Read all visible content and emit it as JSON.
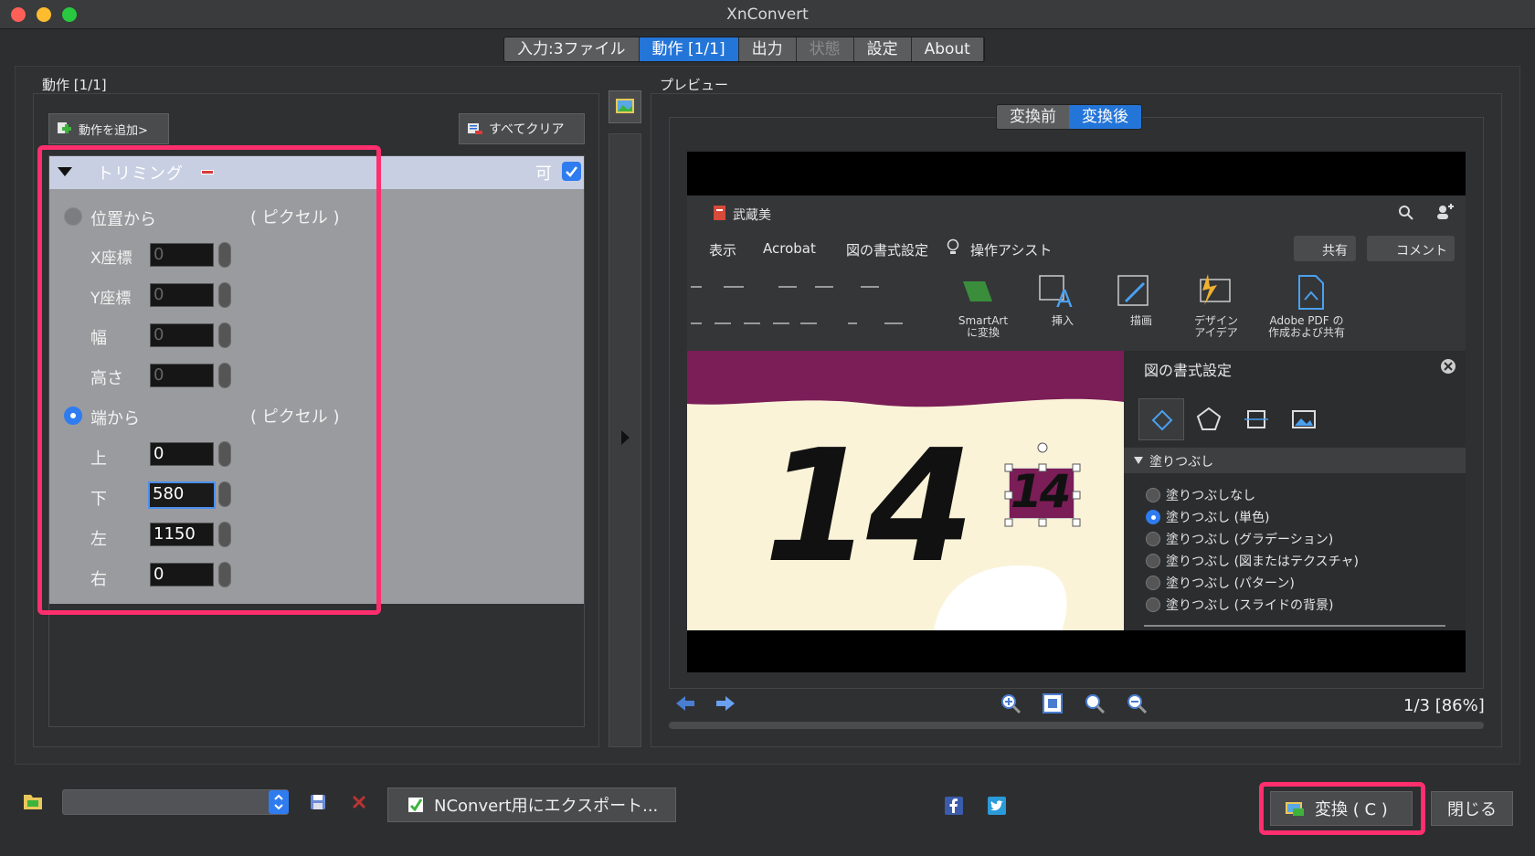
{
  "window": {
    "title": "XnConvert"
  },
  "tabs": [
    {
      "label": "入力:3ファイル",
      "state": "normal"
    },
    {
      "label": "動作 [1/1]",
      "state": "active"
    },
    {
      "label": "出力",
      "state": "normal"
    },
    {
      "label": "状態",
      "state": "disabled"
    },
    {
      "label": "設定",
      "state": "normal"
    },
    {
      "label": "About",
      "state": "normal"
    }
  ],
  "actions_panel": {
    "title": "動作 [1/1]",
    "add_button": "動作を追加>",
    "clear_button": "すべてクリア",
    "trim": {
      "title": "トリミング",
      "enabled_label": "可",
      "enabled": true,
      "from_position": {
        "label": "位置から",
        "unit": "( ピクセル )",
        "selected": false,
        "fields": [
          {
            "label": "X座標",
            "value": "0"
          },
          {
            "label": "Y座標",
            "value": "0"
          },
          {
            "label": "幅",
            "value": "0"
          },
          {
            "label": "高さ",
            "value": "0"
          }
        ]
      },
      "from_edges": {
        "label": "端から",
        "unit": "( ピクセル )",
        "selected": true,
        "fields": [
          {
            "label": "上",
            "value": "0"
          },
          {
            "label": "下",
            "value": "580"
          },
          {
            "label": "左",
            "value": "1150"
          },
          {
            "label": "右",
            "value": "0"
          }
        ]
      }
    }
  },
  "preview": {
    "title": "プレビュー",
    "segments": [
      {
        "label": "変換前",
        "active": false
      },
      {
        "label": "変換後",
        "active": true
      }
    ],
    "page_info": "1/3 [86%]",
    "ppt": {
      "filename": "武蔵美",
      "menu": [
        "表示",
        "Acrobat",
        "図の書式設定",
        "操作アシスト"
      ],
      "share": "共有",
      "comment": "コメント",
      "ribbon": [
        {
          "label": "SmartArt\nに変換"
        },
        {
          "label": "挿入"
        },
        {
          "label": "描画"
        },
        {
          "label": "デザイン\nアイデア"
        },
        {
          "label": "Adobe PDF の\n作成および共有"
        }
      ],
      "slide_number": "14",
      "format_pane": {
        "title": "図の書式設定",
        "section": "塗りつぶし",
        "options": [
          {
            "label": "塗りつぶしなし",
            "on": false
          },
          {
            "label": "塗りつぶし (単色)",
            "on": true
          },
          {
            "label": "塗りつぶし (グラデーション)",
            "on": false
          },
          {
            "label": "塗りつぶし (図またはテクスチャ)",
            "on": false
          },
          {
            "label": "塗りつぶし (パターン)",
            "on": false
          },
          {
            "label": "塗りつぶし (スライドの背景)",
            "on": false
          }
        ]
      }
    }
  },
  "bottom": {
    "export_button": "NConvert用にエクスポート...",
    "convert_button": "変換 ( C )",
    "close_button": "閉じる"
  },
  "colors": {
    "accent": "#2475d8",
    "highlight": "#ff2e6e"
  }
}
